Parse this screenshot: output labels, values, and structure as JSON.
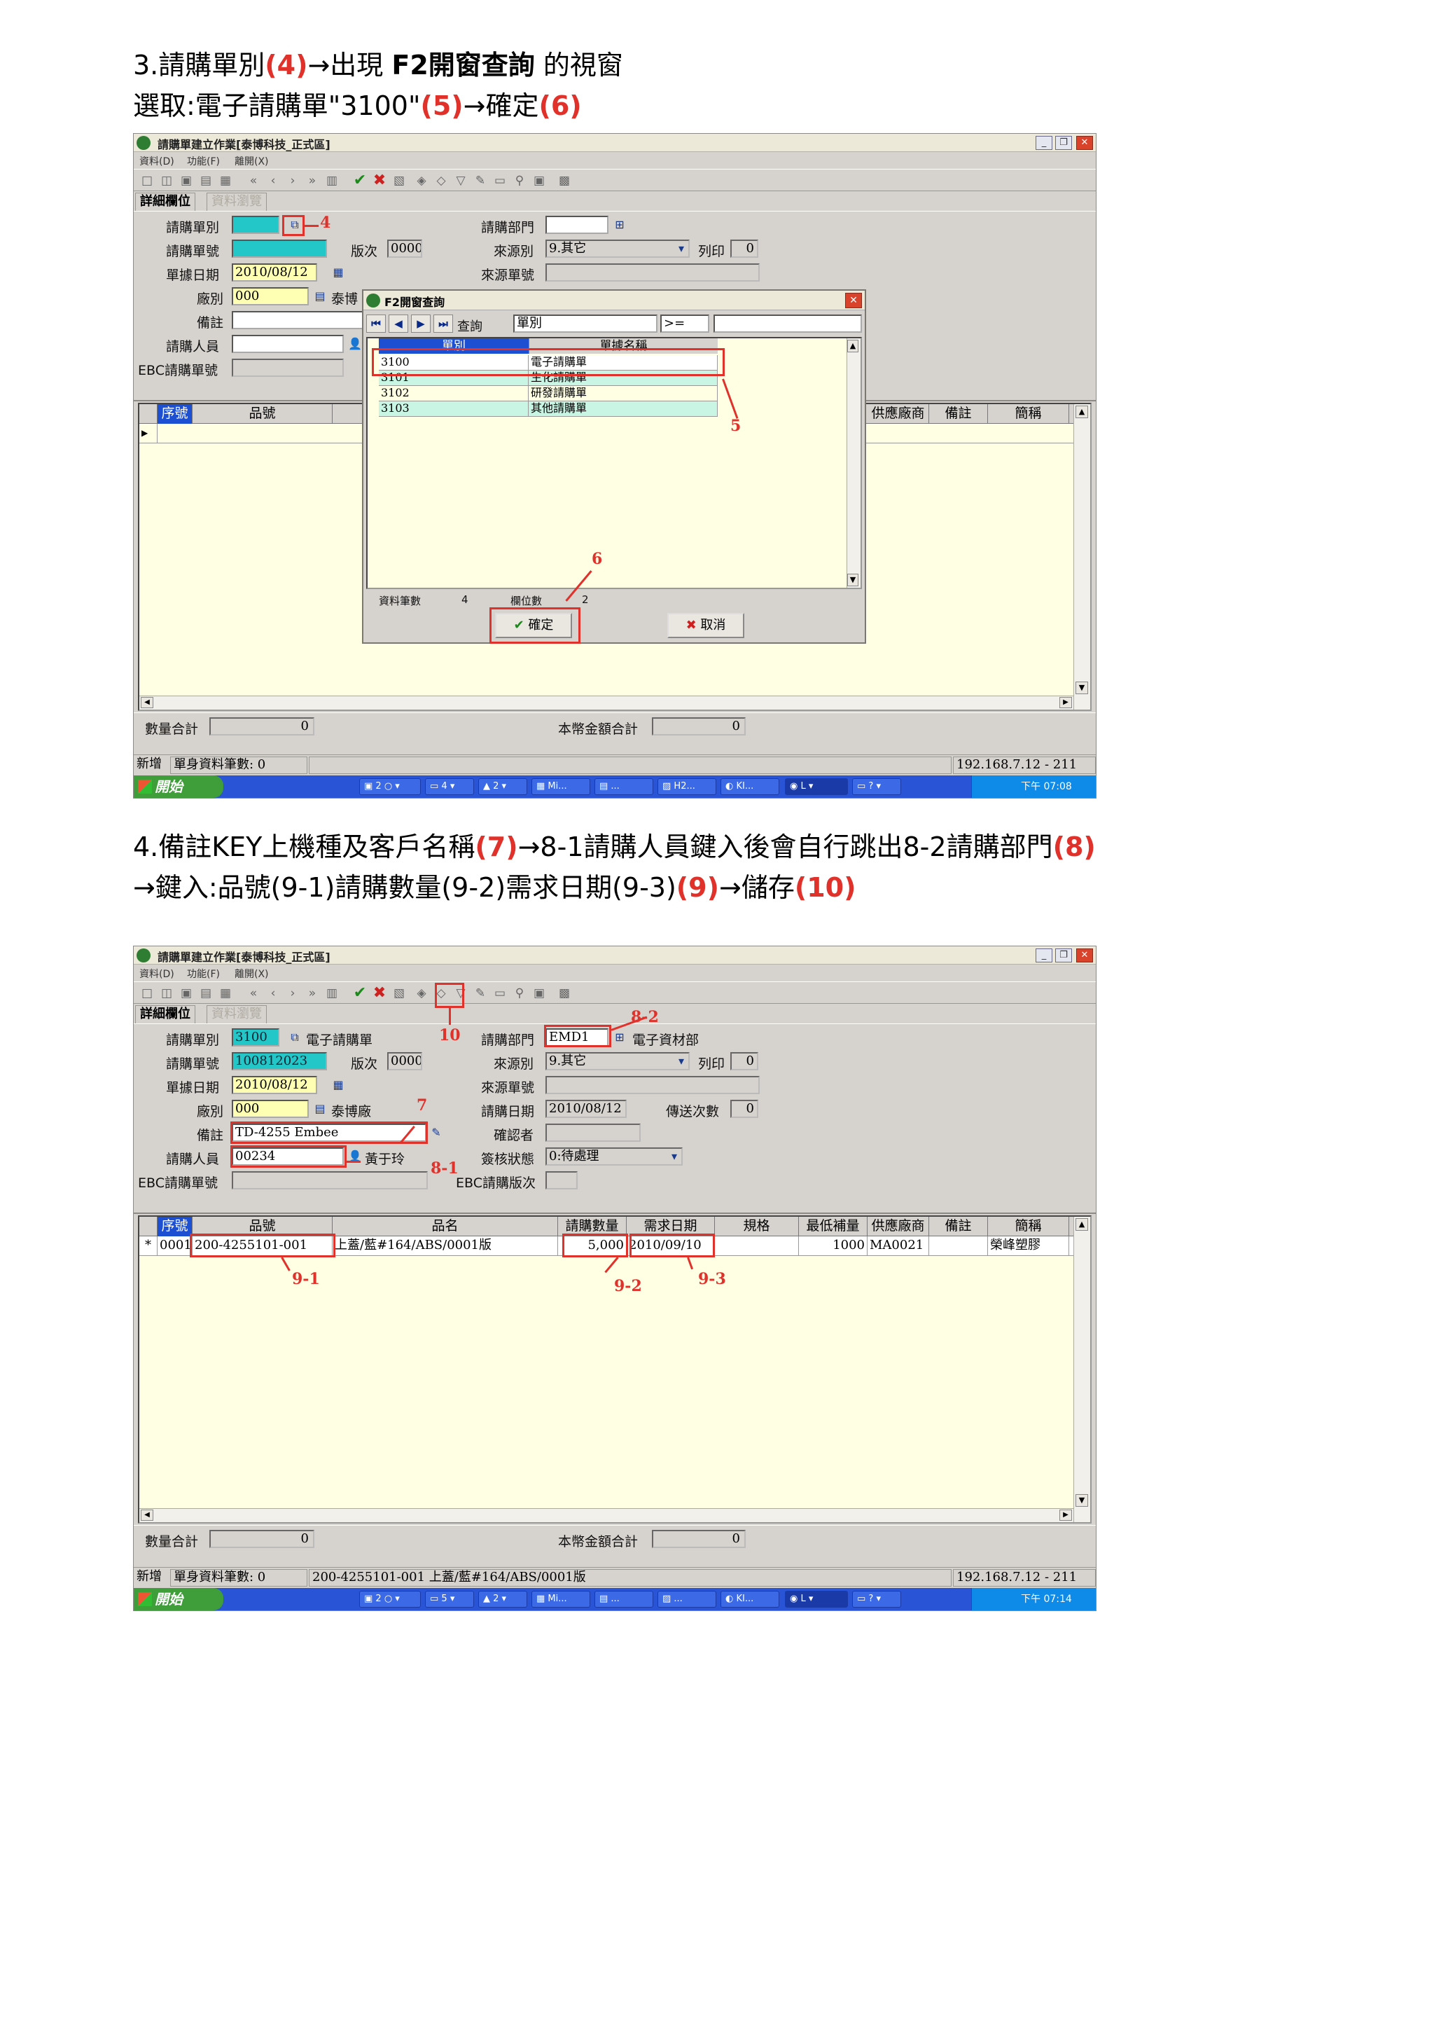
{
  "step3": {
    "line1_a": "3.請購單別",
    "line1_n": "(4)",
    "line1_b": "→出現 ",
    "line1_c": "F2開窗查詢",
    "line1_d": " 的視窗",
    "line2_a": "選取:電子請購單\"3100\"",
    "line2_n5": "(5)",
    "line2_b": "→確定",
    "line2_n6": "(6)"
  },
  "step4": {
    "line1_a": "4.備註KEY上機種及客戶名稱",
    "line1_n7": "(7)",
    "line1_b": "→8-1請購人員鍵入後會自行跳出8-2請購部門",
    "line1_n8": "(8)",
    "line2_a": "→鍵入:品號(9-1)請購數量(9-2)需求日期(9-3)",
    "line2_n9": "(9)",
    "line2_b": "→儲存",
    "line2_n10": "(10)"
  },
  "app": {
    "title": "請購單建立作業[泰博科技_正式區]",
    "menu": [
      "資料(D)",
      "功能(F)",
      "離開(X)"
    ],
    "tabs": [
      "詳細欄位",
      "資料瀏覽"
    ],
    "labels": {
      "req_type": "請購單別",
      "req_no": "請購單號",
      "doc_date": "單據日期",
      "plant": "廠別",
      "remark": "備註",
      "requester": "請購人員",
      "ebc_no": "EBC請購單號",
      "version": "版次",
      "dept": "請購部門",
      "source": "來源別",
      "print": "列印",
      "source_no": "來源單號",
      "req_date": "請購日期",
      "send_count": "傳送次數",
      "confirmer": "確認者",
      "sign_status": "簽核狀態",
      "ebc_version": "EBC請購版次"
    },
    "columns1": [
      "序號",
      "品號"
    ],
    "columns1_right": [
      "供應廠商",
      "備註",
      "簡稱"
    ],
    "columns2": [
      "序號",
      "品號",
      "品名",
      "請購數量",
      "需求日期",
      "規格",
      "最低補量",
      "供應廠商",
      "備註",
      "簡稱"
    ],
    "sum_qty_label": "數量合計",
    "sum_amt_label": "本幣金額合計",
    "status_mode": "新增",
    "ip": "192.168.7.12 - 211",
    "start": "開始",
    "time1": "下午 07:08",
    "time2": "下午 07:14"
  },
  "shot1": {
    "doc_date": "2010/08/12",
    "plant": "000",
    "plant_name": "泰博",
    "version": "0000",
    "source": "9.其它",
    "print": "0",
    "sum_qty": "0",
    "sum_amt": "0",
    "status_count": "單身資料筆數: 0"
  },
  "dialog": {
    "title": "F2開窗查詢",
    "search_label": "查詢",
    "search_field": "單別",
    "op": ">=",
    "headers": [
      "單別",
      "單據名稱"
    ],
    "rows": [
      {
        "code": "3100",
        "name": "電子請購單"
      },
      {
        "code": "3101",
        "name": "生化請購單"
      },
      {
        "code": "3102",
        "name": "研發請購單"
      },
      {
        "code": "3103",
        "name": "其他請購單"
      }
    ],
    "records_label": "資料筆數",
    "records": "4",
    "fields_label": "欄位數",
    "fields": "2",
    "ok": "確定",
    "cancel": "取消"
  },
  "shot2": {
    "req_type": "3100",
    "req_type_name": "電子請購單",
    "req_no": "100812023",
    "version": "0000",
    "doc_date": "2010/08/12",
    "plant": "000",
    "plant_name": "泰博廠",
    "remark": "TD-4255 Embee",
    "requester": "00234",
    "requester_name": "黃于玲",
    "dept": "EMD1",
    "dept_name": "電子資材部",
    "source": "9.其它",
    "print": "0",
    "req_date": "2010/08/12",
    "send_count": "0",
    "sign_status": "0:待處理",
    "row": {
      "seq": "0001",
      "part": "200-4255101-001",
      "desc": "上蓋/藍#164/ABS/0001版",
      "qty": "5,000",
      "date": "2010/09/10",
      "minqty": "1000",
      "vendor": "MA0021",
      "short": "榮峰塑膠"
    },
    "sum_qty": "0",
    "sum_amt": "0",
    "status_count": "單身資料筆數: 0",
    "status_item": "200-4255101-001 上蓋/藍#164/ABS/0001版"
  },
  "annotations": {
    "a4": "4",
    "a5": "5",
    "a6": "6",
    "a7": "7",
    "a81": "8-1",
    "a82": "8-2",
    "a91": "9-1",
    "a92": "9-2",
    "a93": "9-3",
    "a10": "10"
  },
  "colors": {
    "annotation": "#e0312b",
    "cyan_field": "#23c7c7",
    "yellow_field": "#ffffb4",
    "grid_bg": "#ffffe4",
    "header_blue": "#1c4fd2"
  }
}
